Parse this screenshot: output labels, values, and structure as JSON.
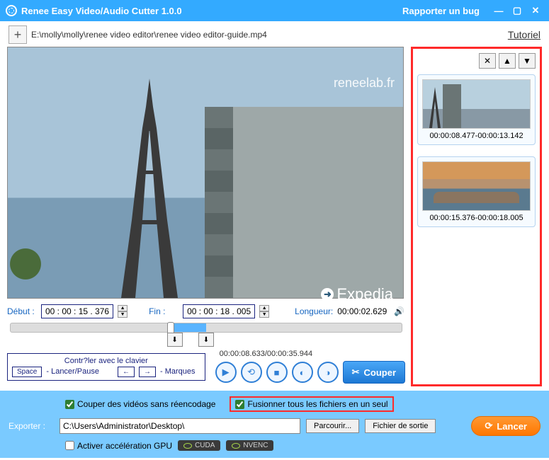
{
  "titlebar": {
    "title": "Renee Easy Video/Audio Cutter 1.0.0",
    "bug": "Rapporter un bug"
  },
  "pathbar": {
    "path": "E:\\molly\\molly\\renee video editor\\renee video editor-guide.mp4",
    "tutoriel": "Tutoriel"
  },
  "video": {
    "watermark_top": "reneelab.fr",
    "watermark_bot": "Expedia"
  },
  "time": {
    "debut_label": "Début :",
    "debut_value": "00 : 00 : 15 . 376",
    "fin_label": "Fin :",
    "fin_value": "00 : 00 : 18 . 005",
    "longueur_label": "Longueur:",
    "longueur_value": "00:00:02.629"
  },
  "keyboard": {
    "title": "Contr?ler avec le clavier",
    "space": "Space",
    "space_label": "- Lancer/Pause",
    "arrows": "← →",
    "arrows_label": "- Marques"
  },
  "controls": {
    "pos_total": "00:00:08.633/00:00:35.944",
    "couper": "Couper"
  },
  "clips": {
    "items": [
      {
        "range": "00:00:08.477-00:00:13.142"
      },
      {
        "range": "00:00:15.376-00:00:18.005"
      }
    ]
  },
  "bottom": {
    "opt1": "Couper des vidéos sans réencodage",
    "opt2": "Fusionner tous les fichiers en un seul",
    "exporter_label": "Exporter :",
    "exporter_path": "C:\\Users\\Administrator\\Desktop\\",
    "parcourir": "Parcourir...",
    "fichier_sortie": "Fichier de sortie",
    "lancer": "Lancer",
    "gpu_label": "Activer accélération GPU",
    "cuda": "CUDA",
    "nvenc": "NVENC"
  }
}
